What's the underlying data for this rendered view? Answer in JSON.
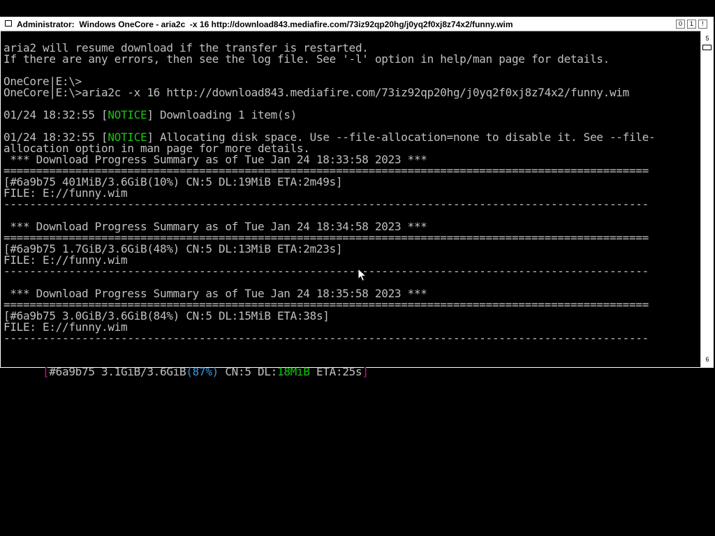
{
  "window": {
    "title": "Administrator:  Windows OneCore - aria2c  -x 16 http://download843.mediafire.com/73iz92qp20hg/j0yq2f0xj8z74x2/funny.wim",
    "buttons": [
      "0",
      "1",
      "!"
    ]
  },
  "scrollbar": {
    "up_label": "5",
    "down_label": "6"
  },
  "console": {
    "lines": [
      {
        "text": "aria2 will resume download if the transfer is restarted."
      },
      {
        "text": "If there are any errors, then see the log file. See '-l' option in help/man page for details."
      },
      {
        "text": ""
      },
      {
        "text": "OneCore|E:\\>"
      },
      {
        "text": "OneCore|E:\\>aria2c -x 16 http://download843.mediafire.com/73iz92qp20hg/j0yq2f0xj8z74x2/funny.wim"
      },
      {
        "text": ""
      },
      {
        "pre": "01/24 18:32:55 [",
        "notice": "NOTICE",
        "post": "] Downloading 1 item(s)"
      },
      {
        "text": ""
      },
      {
        "pre": "01/24 18:32:55 [",
        "notice": "NOTICE",
        "post": "] Allocating disk space. Use --file-allocation=none to disable it. See --file-"
      },
      {
        "text": "allocation option in man page for more details."
      },
      {
        "text": " *** Download Progress Summary as of Tue Jan 24 18:33:58 2023 ***"
      },
      {
        "text": "==================================================================================================="
      },
      {
        "text": "[#6a9b75 401MiB/3.6GiB(10%) CN:5 DL:19MiB ETA:2m49s]"
      },
      {
        "text": "FILE: E://funny.wim"
      },
      {
        "text": "---------------------------------------------------------------------------------------------------"
      },
      {
        "text": ""
      },
      {
        "text": " *** Download Progress Summary as of Tue Jan 24 18:34:58 2023 ***"
      },
      {
        "text": "==================================================================================================="
      },
      {
        "text": "[#6a9b75 1.7GiB/3.6GiB(48%) CN:5 DL:13MiB ETA:2m23s]"
      },
      {
        "text": "FILE: E://funny.wim"
      },
      {
        "text": "---------------------------------------------------------------------------------------------------"
      },
      {
        "text": ""
      },
      {
        "text": " *** Download Progress Summary as of Tue Jan 24 18:35:58 2023 ***"
      },
      {
        "text": "==================================================================================================="
      },
      {
        "text": "[#6a9b75 3.0GiB/3.6GiB(84%) CN:5 DL:15MiB ETA:38s]"
      },
      {
        "text": "FILE: E://funny.wim"
      },
      {
        "text": "---------------------------------------------------------------------------------------------------"
      },
      {
        "text": ""
      }
    ],
    "status_line": {
      "open_bracket": "[",
      "gid": "#6a9b75 3.1GiB/3.6GiB",
      "percent": "(87%)",
      "cn": " CN:5 DL:",
      "speed": "18MiB",
      "eta": " ETA:25s",
      "close_bracket": "]"
    }
  },
  "colors": {
    "background": "#000000",
    "text": "#c0c0c0",
    "notice": "#16c60c",
    "bracket": "#c50f8f",
    "percent": "#3a96dd",
    "speed": "#16c60c"
  },
  "cursor": "mouse-pointer-icon"
}
